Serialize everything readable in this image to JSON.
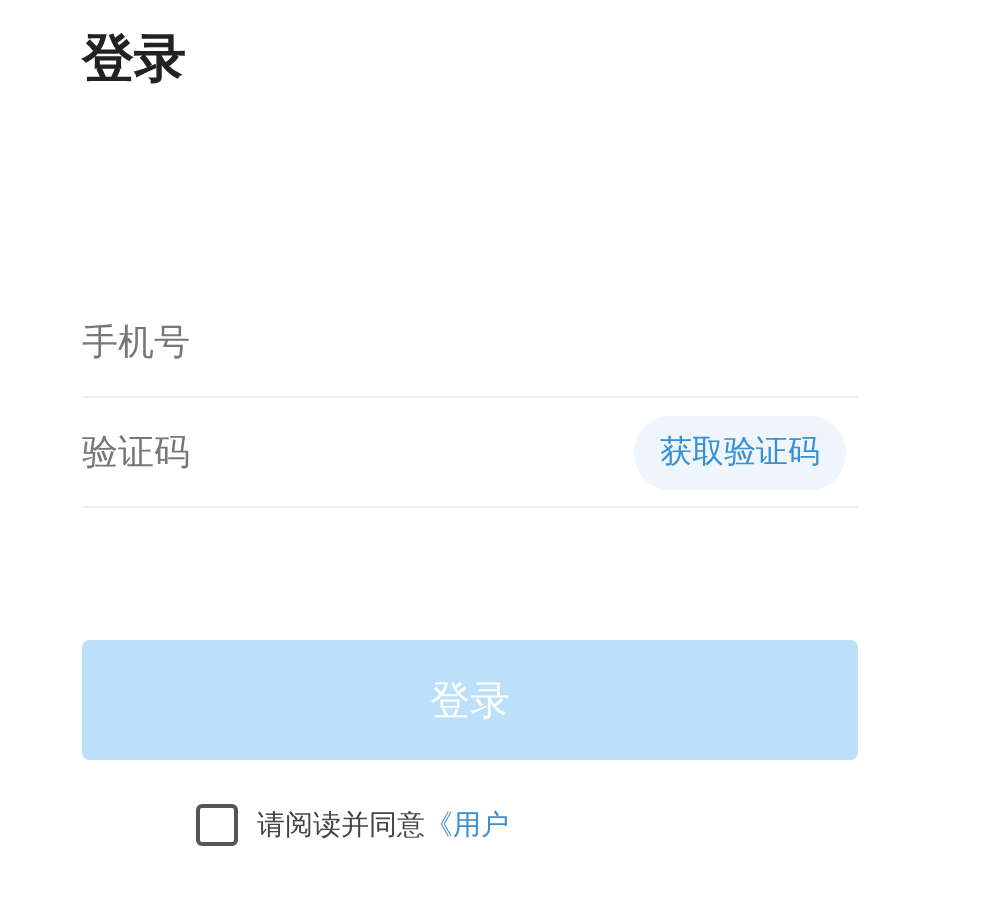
{
  "title": "登录",
  "fields": [
    {
      "placeholder": "手机号"
    },
    {
      "placeholder": "验证码",
      "action": "获取验证码"
    }
  ],
  "login_button": {
    "label": "登录",
    "disabled": true
  },
  "agreement": {
    "checked": false,
    "text": "请阅读并同意",
    "link": "《用户"
  }
}
